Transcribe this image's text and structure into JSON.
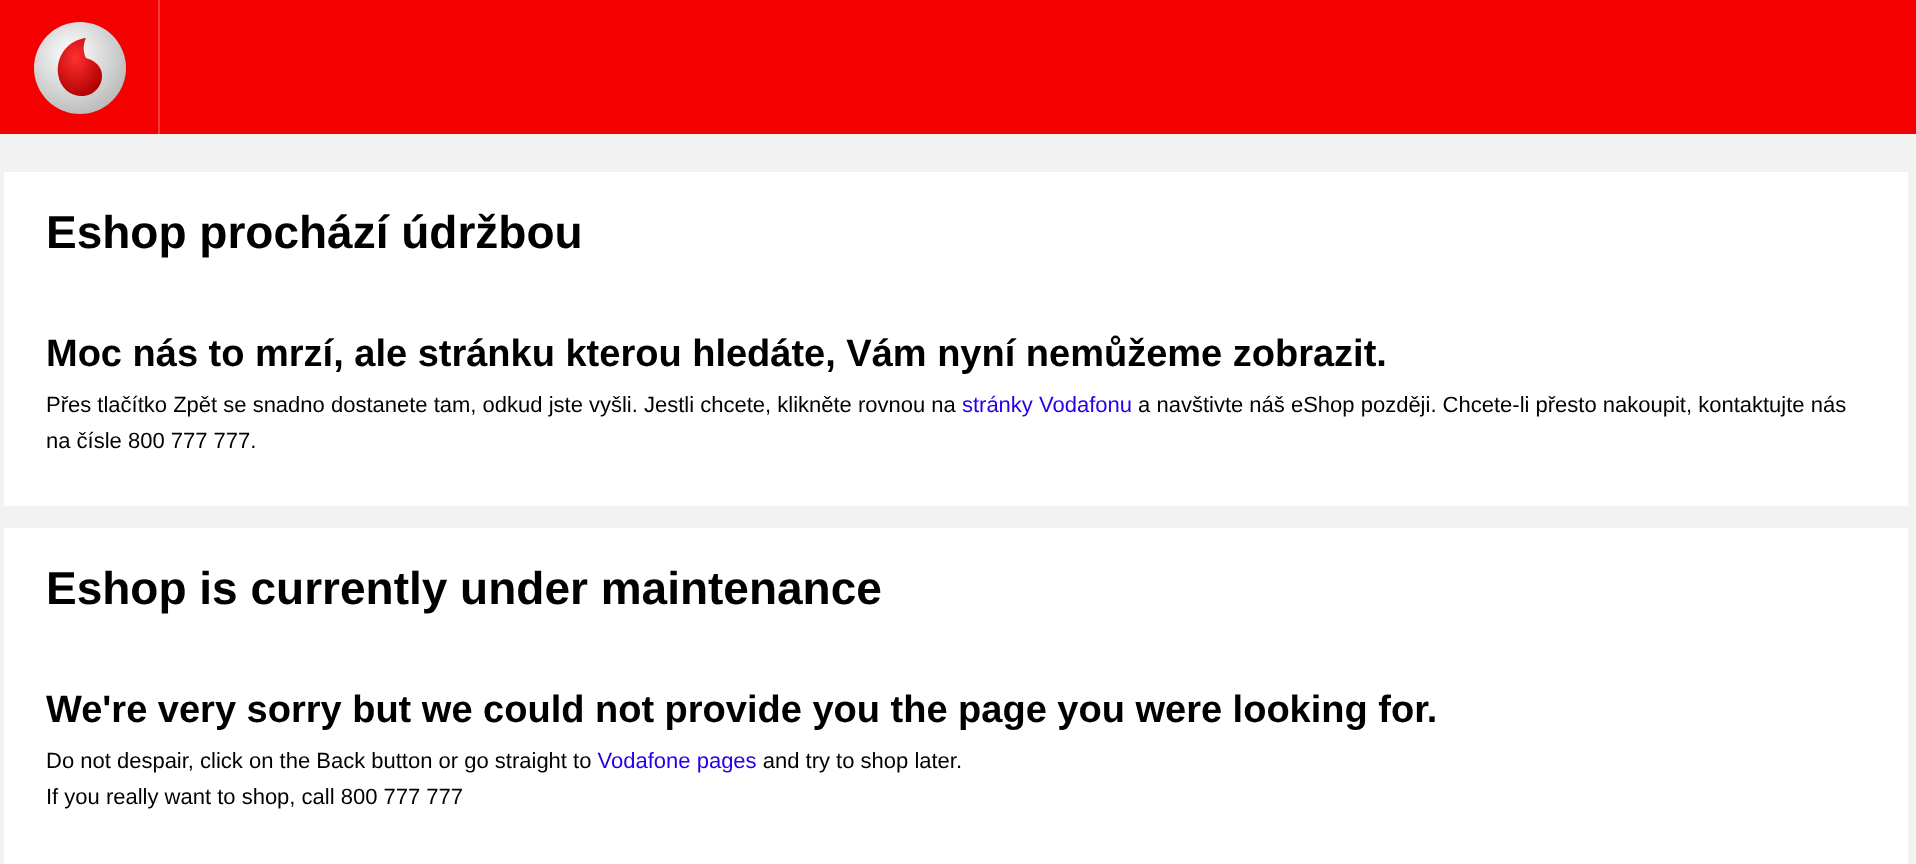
{
  "sections": [
    {
      "title": "Eshop prochází údržbou",
      "subtitle": "Moc nás to mrzí, ale stránku kterou hledáte, Vám nyní nemůžeme zobrazit.",
      "lines": [
        {
          "before": "Přes tlačítko Zpět se snadno dostanete tam, odkud jste vyšli. Jestli chcete, klikněte rovnou na ",
          "link": "stránky Vodafonu",
          "after": " a navštivte náš eShop později. Chcete-li přesto nakoupit, kontaktujte nás na čísle 800 777 777."
        }
      ]
    },
    {
      "title": "Eshop is currently under maintenance",
      "subtitle": "We're very sorry but we could not provide you the page you were looking for.",
      "lines": [
        {
          "before": "Do not despair, click on the Back button or go straight to ",
          "link": "Vodafone pages",
          "after": " and try to shop later."
        },
        {
          "before": "If you really want to shop, call 800 777 777"
        }
      ]
    }
  ]
}
